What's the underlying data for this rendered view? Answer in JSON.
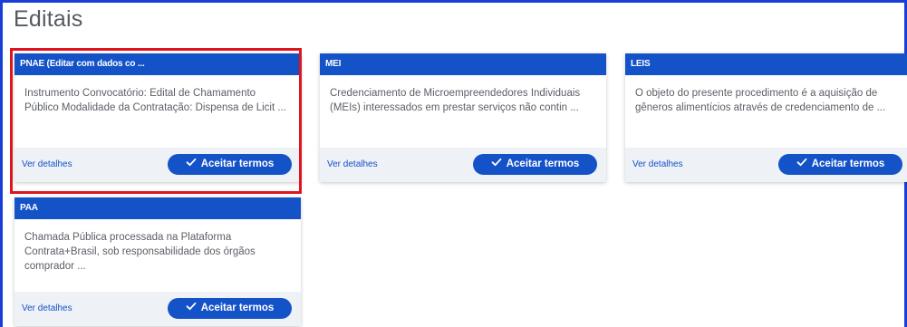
{
  "page": {
    "title": "Editais"
  },
  "colors": {
    "primary": "#1452c8",
    "highlight": "#e0141e",
    "frame": "#1a3fd6",
    "footer_bg": "#eef1f5"
  },
  "cards": [
    {
      "header": "PNAE (Editar com dados co ...",
      "description": "Instrumento Convocatório: Edital de Chamamento Público Modalidade da Contratação: Dispensa de Licit ...",
      "details_label": "Ver detalhes",
      "accept_label": "Aceitar termos",
      "accept_icon": "check-icon",
      "highlighted": true
    },
    {
      "header": "MEI",
      "description": "Credenciamento de Microempreendedores Individuais (MEIs) interessados em prestar serviços não contin ...",
      "details_label": "Ver detalhes",
      "accept_label": "Aceitar termos",
      "accept_icon": "check-icon",
      "highlighted": false
    },
    {
      "header": "LEIS",
      "description": "O objeto do presente procedimento é a aquisição de gêneros alimentícios através de credenciamento de ...",
      "details_label": "Ver detalhes",
      "accept_label": "Aceitar termos",
      "accept_icon": "check-icon",
      "highlighted": false
    },
    {
      "header": "PAA",
      "description": "Chamada Pública processada na Plataforma Contrata+Brasil, sob responsabilidade dos órgãos comprador ...",
      "details_label": "Ver detalhes",
      "accept_label": "Aceitar termos",
      "accept_icon": "check-icon",
      "highlighted": false
    }
  ]
}
